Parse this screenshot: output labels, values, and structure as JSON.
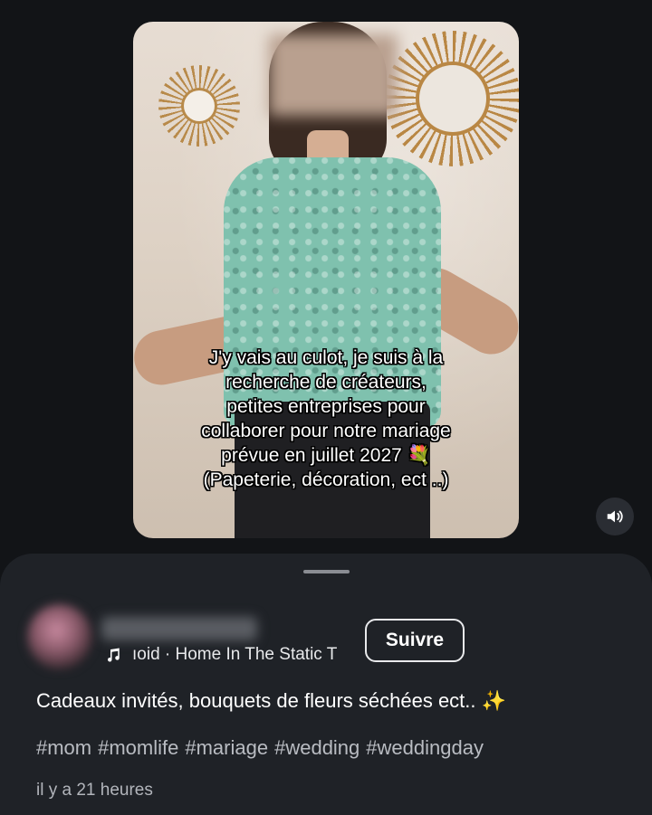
{
  "video": {
    "caption_lines": [
      "J'y vais au culot, je suis à la",
      "recherche de créateurs,",
      "petites entreprises pour",
      "collaborer pour notre mariage",
      "prévue en juillet 2027 💐",
      "(Papeterie, décoration, ect ..)"
    ],
    "mute_icon": "speaker-volume-icon"
  },
  "post": {
    "music_icon": "music-note-icon",
    "music_text": "ıoid · Home In The Static   T",
    "follow_label": "Suivre",
    "description": "Cadeaux invités, bouquets de fleurs séchées ect.. ✨",
    "hashtags": [
      "#mom",
      "#momlife",
      "#mariage",
      "#wedding",
      "#weddingday"
    ],
    "timestamp": "il y a 21 heures"
  },
  "colors": {
    "background": "#121417",
    "sheet": "#1f2227",
    "text_primary": "#ffffff",
    "text_secondary": "#b9bcc2"
  }
}
